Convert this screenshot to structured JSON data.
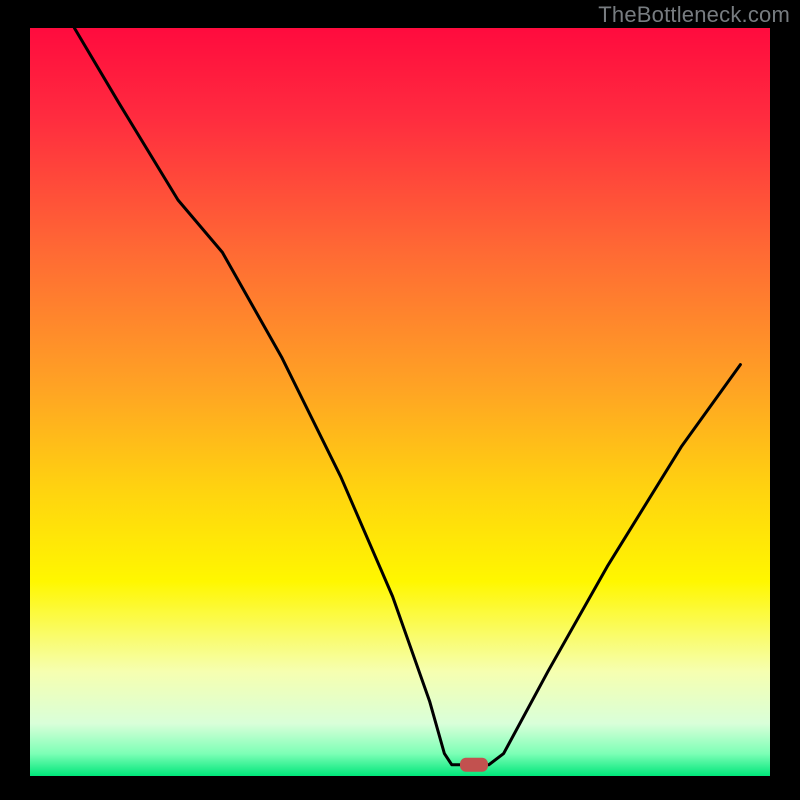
{
  "watermark": "TheBottleneck.com",
  "colors": {
    "black": "#000000",
    "curve": "#000000",
    "marker": "#c2514f",
    "gradient_stops": [
      {
        "offset": 0.0,
        "color": "#ff0b3e"
      },
      {
        "offset": 0.12,
        "color": "#ff2c3f"
      },
      {
        "offset": 0.3,
        "color": "#ff6a34"
      },
      {
        "offset": 0.48,
        "color": "#ffa324"
      },
      {
        "offset": 0.62,
        "color": "#ffd40f"
      },
      {
        "offset": 0.74,
        "color": "#fff700"
      },
      {
        "offset": 0.86,
        "color": "#f6ffb0"
      },
      {
        "offset": 0.93,
        "color": "#d9ffd9"
      },
      {
        "offset": 0.97,
        "color": "#7dffb6"
      },
      {
        "offset": 1.0,
        "color": "#00e67a"
      }
    ]
  },
  "chart_data": {
    "type": "line",
    "title": "",
    "xlabel": "",
    "ylabel": "",
    "xlim": [
      0,
      100
    ],
    "ylim": [
      0,
      100
    ],
    "note": "Axes are unlabelled; values are approximate positions read from the image on a 0–100 scale (x left→right, y bottom→top).",
    "series": [
      {
        "name": "bottleneck-curve",
        "points": [
          {
            "x": 6,
            "y": 100
          },
          {
            "x": 12,
            "y": 90
          },
          {
            "x": 20,
            "y": 77
          },
          {
            "x": 26,
            "y": 70
          },
          {
            "x": 34,
            "y": 56
          },
          {
            "x": 42,
            "y": 40
          },
          {
            "x": 49,
            "y": 24
          },
          {
            "x": 54,
            "y": 10
          },
          {
            "x": 56,
            "y": 3
          },
          {
            "x": 57,
            "y": 1.5
          },
          {
            "x": 62,
            "y": 1.5
          },
          {
            "x": 64,
            "y": 3
          },
          {
            "x": 70,
            "y": 14
          },
          {
            "x": 78,
            "y": 28
          },
          {
            "x": 88,
            "y": 44
          },
          {
            "x": 96,
            "y": 55
          }
        ]
      }
    ],
    "marker": {
      "x": 60,
      "y": 1.5,
      "shape": "rounded-rect"
    }
  }
}
